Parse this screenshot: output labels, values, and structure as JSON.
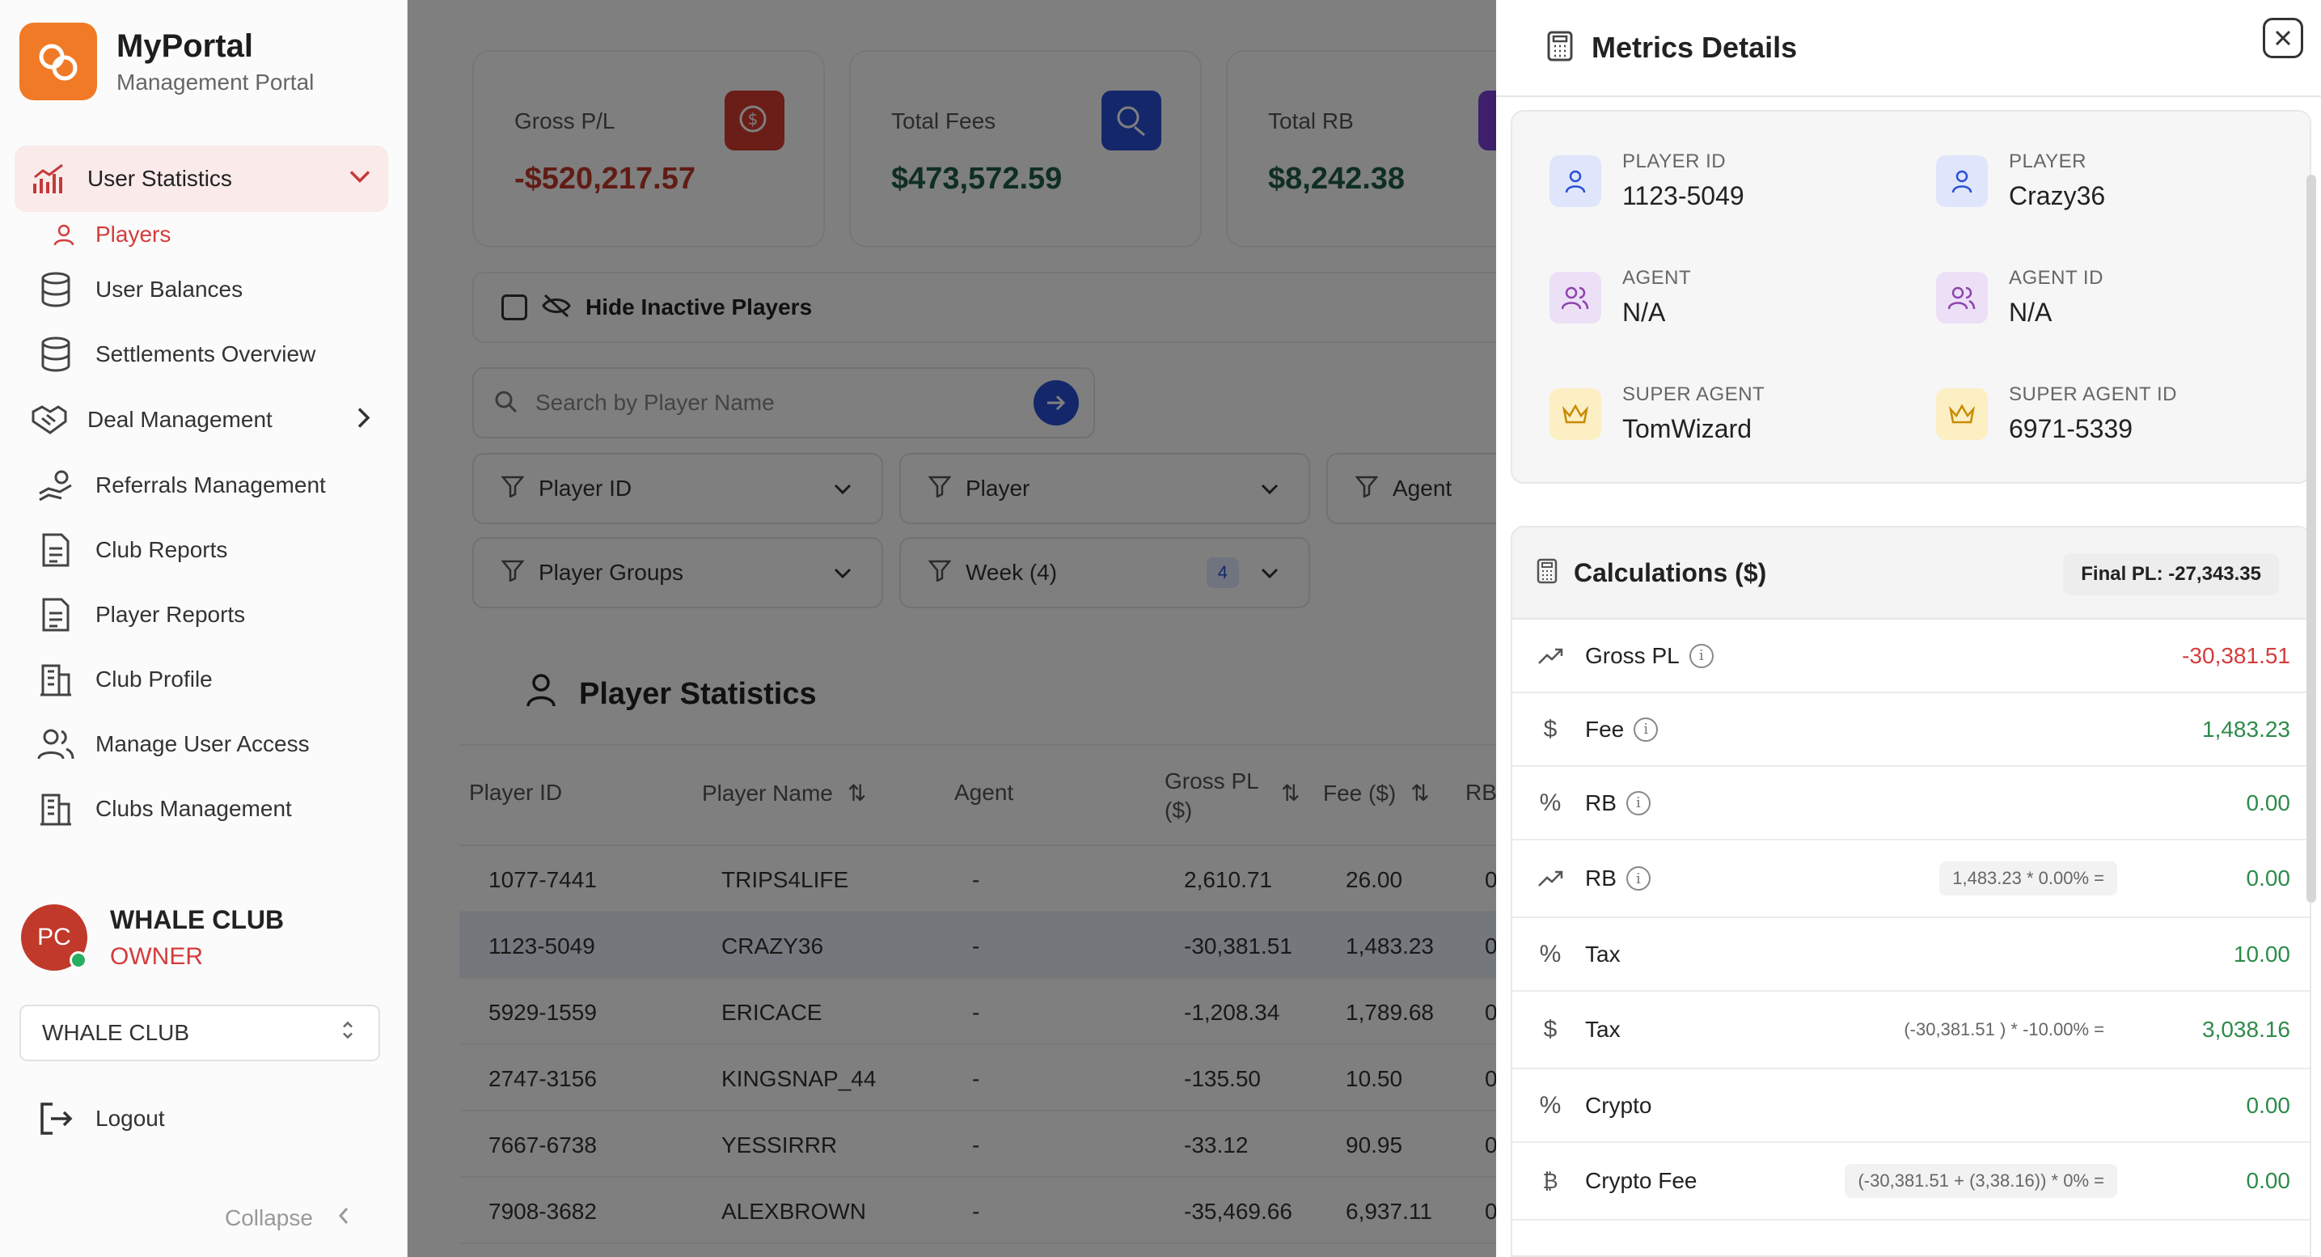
{
  "brand": {
    "title": "MyPortal",
    "subtitle": "Management Portal"
  },
  "sidebar": {
    "user_statistics": "User Statistics",
    "players": "Players",
    "items": [
      "User Balances",
      "Settlements Overview",
      "Deal Management",
      "Referrals Management",
      "Club Reports",
      "Player Reports",
      "Club Profile",
      "Manage User Access",
      "Clubs Management"
    ],
    "user": {
      "initials": "PC",
      "name": "WHALE CLUB",
      "role": "OWNER"
    },
    "club_select": "WHALE CLUB",
    "logout": "Logout",
    "collapse": "Collapse"
  },
  "cards": [
    {
      "label": "Gross P/L",
      "value": "-$520,217.57",
      "color": "#c0392b"
    },
    {
      "label": "Total Fees",
      "value": "$473,572.59",
      "color": "#1f5c4a"
    },
    {
      "label": "Total RB",
      "value": "$8,242.38",
      "color": "#1f5c4a"
    }
  ],
  "controls": {
    "hide_inactive": "Hide Inactive Players",
    "search_placeholder": "Search by Player Name",
    "filters": {
      "player_id": "Player ID",
      "player": "Player",
      "agent": "Agent",
      "player_groups": "Player Groups",
      "week": "Week (4)",
      "week_badge": "4"
    }
  },
  "table": {
    "title": "Player Statistics",
    "headers": {
      "player_id": "Player ID",
      "player_name": "Player Name",
      "agent": "Agent",
      "gross_pl_1": "Gross PL",
      "gross_pl_2": "($)",
      "fee": "Fee ($)",
      "rb": "RB"
    },
    "rows": [
      {
        "id": "1077-7441",
        "name": "TRIPS4LIFE",
        "agent": "-",
        "gross": "2,610.71",
        "fee": "26.00",
        "rb": "0"
      },
      {
        "id": "1123-5049",
        "name": "CRAZY36",
        "agent": "-",
        "gross": "-30,381.51",
        "fee": "1,483.23",
        "rb": "0"
      },
      {
        "id": "5929-1559",
        "name": "ERICACE",
        "agent": "-",
        "gross": "-1,208.34",
        "fee": "1,789.68",
        "rb": "0"
      },
      {
        "id": "2747-3156",
        "name": "KINGSNAP_44",
        "agent": "-",
        "gross": "-135.50",
        "fee": "10.50",
        "rb": "0"
      },
      {
        "id": "7667-6738",
        "name": "YESSIRRR",
        "agent": "-",
        "gross": "-33.12",
        "fee": "90.95",
        "rb": "0"
      },
      {
        "id": "7908-3682",
        "name": "ALEXBROWN",
        "agent": "-",
        "gross": "-35,469.66",
        "fee": "6,937.11",
        "rb": "0"
      }
    ]
  },
  "drawer": {
    "title": "Metrics Details",
    "info": {
      "player_id": {
        "label": "PLAYER ID",
        "value": "1123-5049"
      },
      "player": {
        "label": "PLAYER",
        "value": "Crazy36"
      },
      "agent": {
        "label": "AGENT",
        "value": "N/A"
      },
      "agent_id": {
        "label": "AGENT ID",
        "value": "N/A"
      },
      "super_agent": {
        "label": "SUPER AGENT",
        "value": "TomWizard"
      },
      "super_agent_id": {
        "label": "SUPER AGENT ID",
        "value": "6971-5339"
      }
    },
    "calc": {
      "title": "Calculations ($)",
      "final_pl": "Final PL: -27,343.35",
      "rows": [
        {
          "label": "Gross PL",
          "value": "-30,381.51",
          "formula": ""
        },
        {
          "label": "Fee",
          "value": "1,483.23",
          "formula": ""
        },
        {
          "label": "RB",
          "value": "0.00",
          "formula": ""
        },
        {
          "label": "RB",
          "value": "0.00",
          "formula": "1,483.23 * 0.00% ="
        },
        {
          "label": "Tax",
          "value": "10.00",
          "formula": ""
        },
        {
          "label": "Tax",
          "value": "3,038.16",
          "formula": "(-30,381.51 ) * -10.00% ="
        },
        {
          "label": "Crypto",
          "value": "0.00",
          "formula": ""
        },
        {
          "label": "Crypto Fee",
          "value": "0.00",
          "formula": "(-30,381.51 + (3,38.16)) * 0% ="
        }
      ]
    }
  }
}
